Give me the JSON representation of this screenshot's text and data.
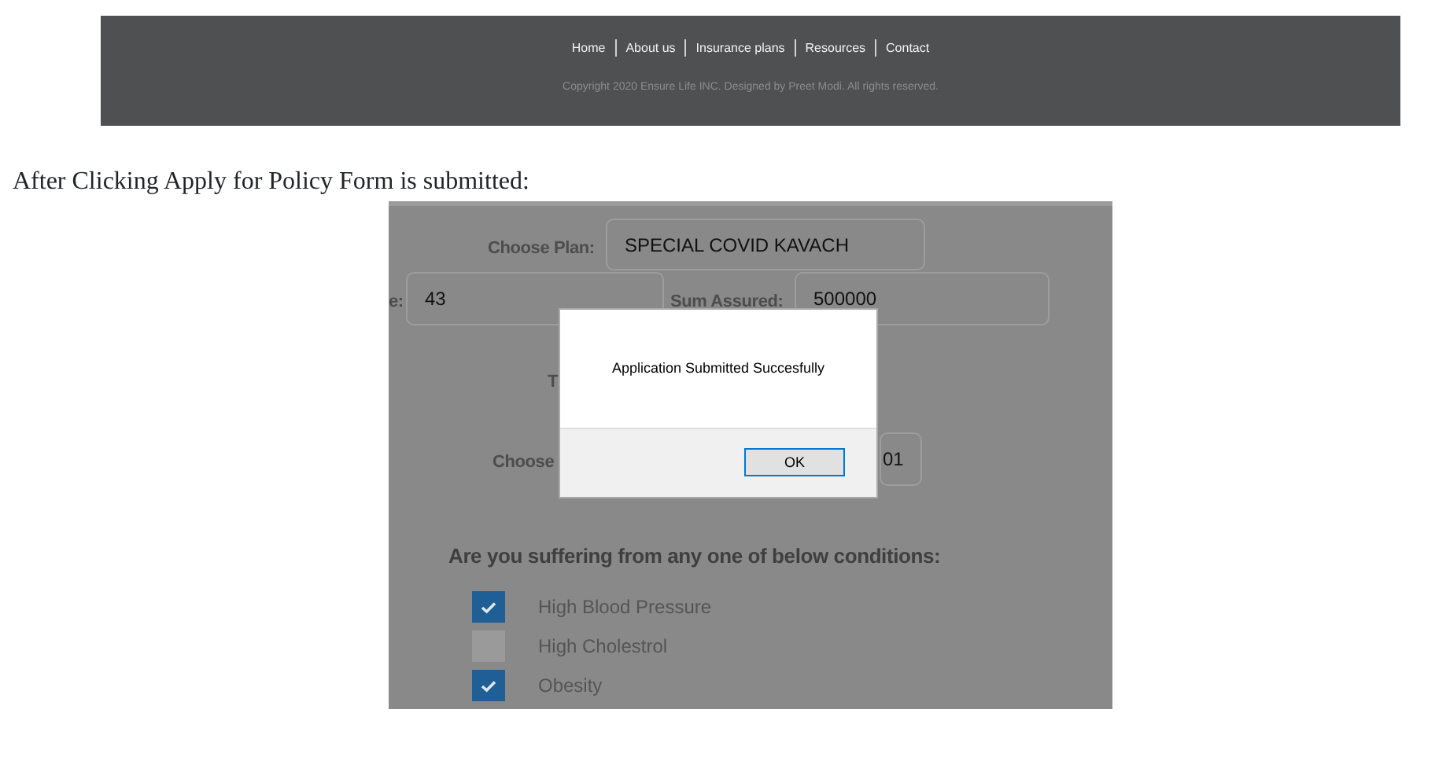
{
  "footer_screenshot": {
    "links": [
      {
        "label": "Home"
      },
      {
        "label": "About us"
      },
      {
        "label": "Insurance plans"
      },
      {
        "label": "Resources"
      },
      {
        "label": "Contact"
      }
    ],
    "copyright": "Copyright 2020 Ensure Life INC. Designed by Preet Modi. All rights reserved."
  },
  "caption": "After Clicking Apply for Policy Form is submitted:",
  "form_screenshot": {
    "plan": {
      "label": "Choose Plan:",
      "value": "SPECIAL COVID KAVACH"
    },
    "age": {
      "label": "e:",
      "value": "43"
    },
    "sum_assured": {
      "label": "Sum Assured:",
      "value": "500000"
    },
    "partial_label": "T",
    "choose_row": {
      "label": "Choose",
      "value": "01"
    },
    "conditions": {
      "heading": "Are you suffering from any one of below conditions:",
      "items": [
        {
          "label": "High Blood Pressure",
          "checked": true
        },
        {
          "label": "High Cholestrol",
          "checked": false
        },
        {
          "label": "Obesity",
          "checked": true
        }
      ]
    },
    "dialog": {
      "message": "Application Submitted Succesfully",
      "button": "OK"
    }
  }
}
